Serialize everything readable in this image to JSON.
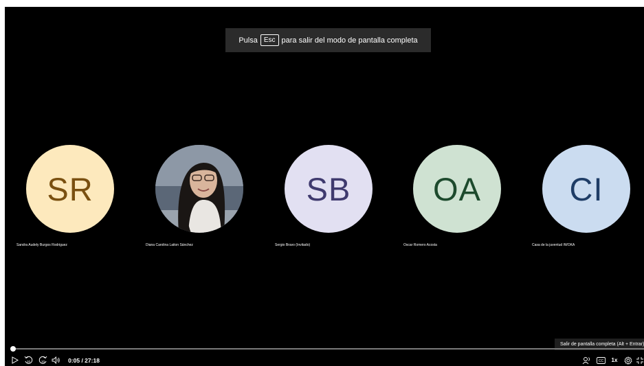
{
  "fullscreen_toast": {
    "before": "Pulsa",
    "key": "Esc",
    "after": "para salir del modo de pantalla completa"
  },
  "participants": [
    {
      "initials": "SR",
      "name": "Sandra Audely Burgos Rodriguez",
      "bg": "#fde9bd",
      "fg": "#7a5010"
    },
    {
      "initials": "",
      "name": "Diana Carolina Laiton Sánchez",
      "photo": true
    },
    {
      "initials": "SB",
      "name": "Sergio Bravo (Invitado)",
      "bg": "#e2e0f2",
      "fg": "#3f3a6e"
    },
    {
      "initials": "OA",
      "name": "Oscar Romero Acosta",
      "bg": "#cfe2d2",
      "fg": "#1d4a2d"
    },
    {
      "initials": "CI",
      "name": "Casa de la juventud IWOKA",
      "bg": "#cbdcf0",
      "fg": "#1f3d66"
    }
  ],
  "player": {
    "current_time": "0:05",
    "duration": "27:18",
    "time_display": "0:05 / 27:18",
    "progress_fraction": 0.003,
    "speed": "1x",
    "cc_label": "CC",
    "skip_back": "10",
    "skip_forward": "10",
    "tooltip": "Salir de pantalla completa (Alt + Entrar)"
  },
  "colors": {
    "background": "#000000",
    "toast_bg": "#2b2b2b"
  },
  "icons": [
    "play-icon",
    "rewind-10-icon",
    "forward-10-icon",
    "volume-icon",
    "transcript-icon",
    "captions-icon",
    "settings-icon",
    "exit-fullscreen-icon"
  ]
}
